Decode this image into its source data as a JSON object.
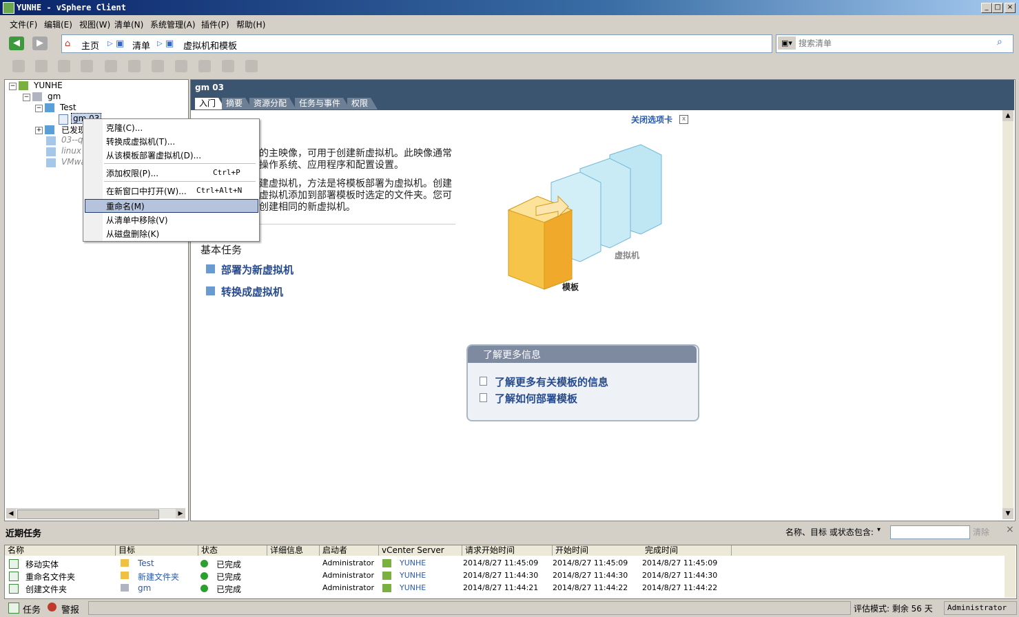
{
  "window": {
    "title": "YUNHE - vSphere Client"
  },
  "menu": [
    "文件(F)",
    "编辑(E)",
    "视图(W)",
    "清单(N)",
    "系统管理(A)",
    "插件(P)",
    "帮助(H)"
  ],
  "breadcrumb": {
    "home": "主页",
    "inventory": "清单",
    "current": "虚拟机和模板"
  },
  "search": {
    "placeholder": "搜索清单"
  },
  "tree": {
    "root": "YUNHE",
    "datacenter": "gm",
    "folder": "Test",
    "selected": "gm 03",
    "discovered": "已发现",
    "vm1": "03--qc",
    "vm2": "linux (",
    "vm3": "VMwa"
  },
  "context_menu": {
    "items": [
      {
        "label": "克隆(C)...",
        "shortcut": ""
      },
      {
        "label": "转换成虚拟机(T)...",
        "shortcut": ""
      },
      {
        "label": "从该模板部署虚拟机(D)...",
        "shortcut": ""
      },
      {
        "label": "添加权限(P)...",
        "shortcut": "Ctrl+P"
      },
      {
        "label": "在新窗口中打开(W)...",
        "shortcut": "Ctrl+Alt+N"
      },
      {
        "label": "重命名(M)",
        "shortcut": ""
      },
      {
        "label": "从清单中移除(V)",
        "shortcut": ""
      },
      {
        "label": "从磁盘删除(K)",
        "shortcut": ""
      }
    ]
  },
  "content": {
    "object_name": "gm 03",
    "tabs": [
      "入门",
      "摘要",
      "资源分配",
      "任务与事件",
      "权限"
    ],
    "close_tab": "关闭选项卡",
    "para1_line1": "的主映像，可用于创建新虚拟机。此映像通常",
    "para1_line2": "操作系统、应用程序和配置设置。",
    "para2_line1": "建虚拟机，方法是将模板部署为虚拟机。创建",
    "para2_line2": "虚拟机添加到部署模板时选定的文件夹。您可",
    "para2_line3": "创建相同的新虚拟机。",
    "basic_tasks": "基本任务",
    "task1": "部署为新虚拟机",
    "task2": "转换成虚拟机",
    "diagram_vm": "虚拟机",
    "diagram_template": "模板",
    "learn_more_title": "了解更多信息",
    "learn1": "了解更多有关模板的信息",
    "learn2": "了解如何部署模板"
  },
  "recent_tasks": {
    "title": "近期任务",
    "filter_label": "名称、目标 或状态包含:",
    "clear": "清除",
    "columns": [
      "名称",
      "目标",
      "状态",
      "详细信息",
      "启动者",
      "vCenter Server",
      "请求开始时间",
      "开始时间",
      "完成时间"
    ],
    "rows": [
      {
        "name": "移动实体",
        "target": "Test",
        "status": "已完成",
        "initiator": "Administrator",
        "vcenter": "YUNHE",
        "requested": "2014/8/27 11:45:09",
        "start": "2014/8/27 11:45:09",
        "end": "2014/8/27 11:45:09"
      },
      {
        "name": "重命名文件夹",
        "target": "新建文件夹",
        "status": "已完成",
        "initiator": "Administrator",
        "vcenter": "YUNHE",
        "requested": "2014/8/27 11:44:30",
        "start": "2014/8/27 11:44:30",
        "end": "2014/8/27 11:44:30"
      },
      {
        "name": "创建文件夹",
        "target": "gm",
        "status": "已完成",
        "initiator": "Administrator",
        "vcenter": "YUNHE",
        "requested": "2014/8/27 11:44:21",
        "start": "2014/8/27 11:44:22",
        "end": "2014/8/27 11:44:22"
      }
    ]
  },
  "statusbar": {
    "tasks": "任务",
    "alarms": "警报",
    "eval": "评估模式: 剩余 56 天",
    "user": "Administrator"
  }
}
